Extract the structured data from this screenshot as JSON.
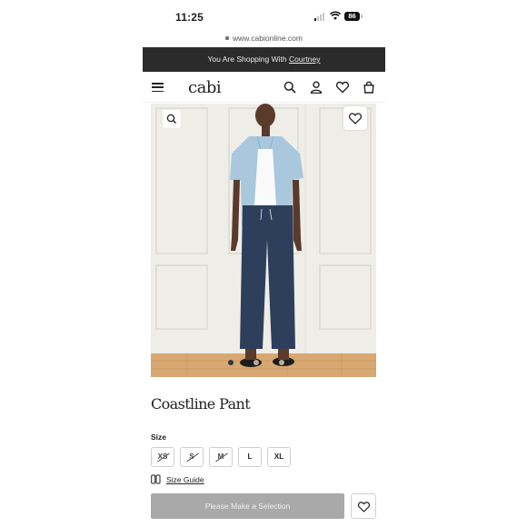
{
  "status_bar": {
    "time": "11:25",
    "battery": "86"
  },
  "browser": {
    "url": "www.cabionline.com"
  },
  "banner": {
    "prefix": "You Are Shopping With ",
    "host": "Courtney"
  },
  "nav": {
    "logo": "cabi",
    "icons": [
      "menu-icon",
      "search-icon",
      "user-icon",
      "heart-icon",
      "bag-icon"
    ]
  },
  "product": {
    "title": "Coastline Pant",
    "image_count": 3,
    "active_image": 1,
    "size_label": "Size",
    "sizes": [
      {
        "label": "XS",
        "available": false
      },
      {
        "label": "S",
        "available": false
      },
      {
        "label": "M",
        "available": false
      },
      {
        "label": "L",
        "available": true
      },
      {
        "label": "XL",
        "available": true
      }
    ],
    "size_guide": "Size Guide",
    "cta": "Please Make a Selection"
  },
  "colors": {
    "banner": "#2b2b2b",
    "cta_disabled": "#a9a9a9",
    "shirt": "#a9c8dd",
    "pant": "#2e3f5c"
  }
}
